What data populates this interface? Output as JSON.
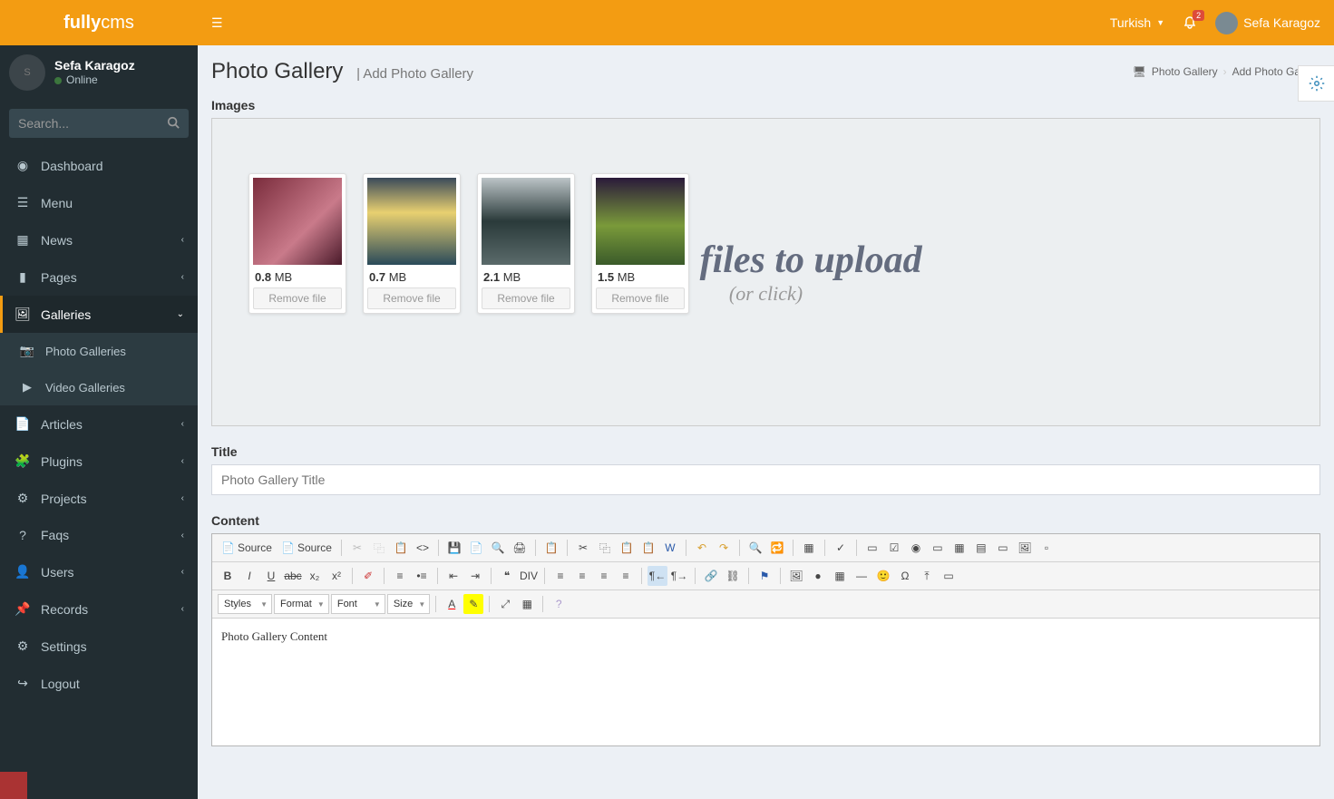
{
  "brand": {
    "bold": "fully",
    "light": "cms"
  },
  "user": {
    "name": "Sefa Karagoz",
    "status": "Online"
  },
  "search": {
    "placeholder": "Search..."
  },
  "nav": [
    {
      "icon": "dashboard",
      "label": "Dashboard",
      "sub": false
    },
    {
      "icon": "menu",
      "label": "Menu",
      "sub": false
    },
    {
      "icon": "news",
      "label": "News",
      "sub": true
    },
    {
      "icon": "pages",
      "label": "Pages",
      "sub": true
    },
    {
      "icon": "galleries",
      "label": "Galleries",
      "sub": true,
      "active": true,
      "open": true,
      "children": [
        {
          "icon": "camera",
          "label": "Photo Galleries"
        },
        {
          "icon": "play",
          "label": "Video Galleries"
        }
      ]
    },
    {
      "icon": "articles",
      "label": "Articles",
      "sub": true
    },
    {
      "icon": "plugins",
      "label": "Plugins",
      "sub": true
    },
    {
      "icon": "projects",
      "label": "Projects",
      "sub": true
    },
    {
      "icon": "faqs",
      "label": "Faqs",
      "sub": true
    },
    {
      "icon": "users",
      "label": "Users",
      "sub": true
    },
    {
      "icon": "records",
      "label": "Records",
      "sub": true
    },
    {
      "icon": "settings",
      "label": "Settings",
      "sub": false
    },
    {
      "icon": "logout",
      "label": "Logout",
      "sub": false
    }
  ],
  "topbar": {
    "language": "Turkish",
    "notifications": "2",
    "user": "Sefa Karagoz"
  },
  "header": {
    "title": "Photo Gallery",
    "subtitle": "| Add Photo Gallery"
  },
  "breadcrumb": {
    "a": "Photo Gallery",
    "b": "Add Photo Gallery"
  },
  "labels": {
    "images": "Images",
    "title": "Title",
    "content": "Content"
  },
  "dropzone": {
    "line1": "Drop files to upload",
    "line2": "(or click)"
  },
  "files": [
    {
      "size_n": "0.8",
      "size_u": "MB",
      "btn": "Remove file"
    },
    {
      "size_n": "0.7",
      "size_u": "MB",
      "btn": "Remove file"
    },
    {
      "size_n": "2.1",
      "size_u": "MB",
      "btn": "Remove file"
    },
    {
      "size_n": "1.5",
      "size_u": "MB",
      "btn": "Remove file"
    }
  ],
  "title_input": {
    "placeholder": "Photo Gallery Title"
  },
  "editor": {
    "source": "Source",
    "dropdowns": {
      "styles": "Styles",
      "format": "Format",
      "font": "Font",
      "size": "Size"
    },
    "content": "Photo Gallery Content"
  }
}
